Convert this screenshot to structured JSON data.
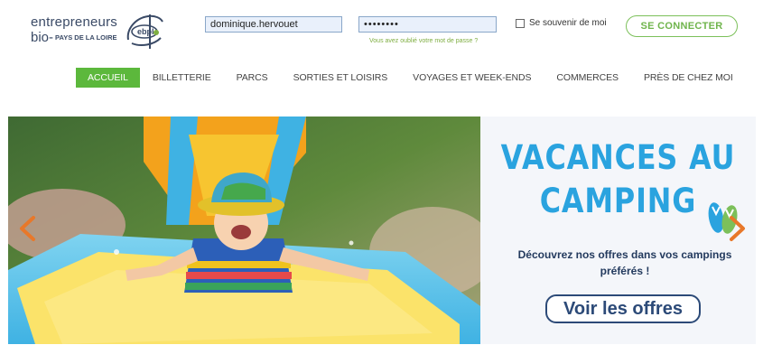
{
  "header": {
    "logo": {
      "line1": "entrepreneurs",
      "line2_bio": "bio-",
      "line2_region": "PAYS DE LA LOIRE",
      "mark": "ebpl"
    },
    "login": {
      "username_value": "dominique.hervouet",
      "password_value": "••••••••",
      "forgot_link": "Vous avez oublié votre mot de passe ?",
      "remember_label": "Se souvenir de moi",
      "remember_checked": false,
      "connect_button": "SE CONNECTER"
    }
  },
  "nav": {
    "items": [
      {
        "label": "ACCUEIL",
        "active": true
      },
      {
        "label": "BILLETTERIE"
      },
      {
        "label": "PARCS"
      },
      {
        "label": "SORTIES ET LOISIRS"
      },
      {
        "label": "VOYAGES ET WEEK-ENDS"
      },
      {
        "label": "COMMERCES"
      },
      {
        "label": "PRÈS DE CHEZ MOI"
      }
    ]
  },
  "banner": {
    "title_line1": "VACANCES AU",
    "title_line2": "CAMPING",
    "text_line1": "Découvrez nos offres dans vos campings",
    "text_line2": "préférés !",
    "button": "Voir les offres",
    "icons": {
      "prev": "chevron-left-icon",
      "next": "chevron-right-icon",
      "decor": "flip-flops-icon"
    }
  },
  "colors": {
    "nav_active": "#5cb83c",
    "connect_green": "#6fb44c",
    "promo_title_blue": "#2aa3df",
    "promo_text_navy": "#233a5e",
    "arrow_orange": "#e8782a"
  }
}
